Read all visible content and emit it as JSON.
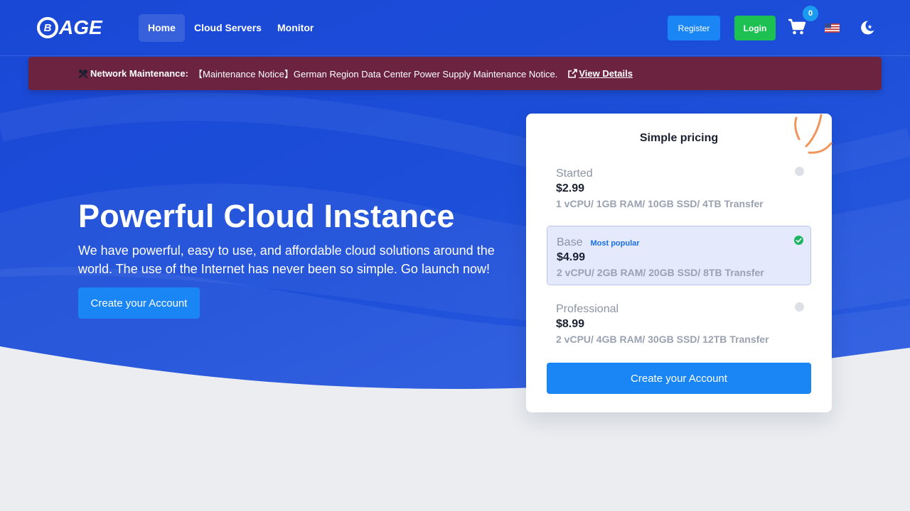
{
  "brand": {
    "logo_text": "AGE",
    "logo_mark": "B"
  },
  "nav": {
    "items": [
      {
        "label": "Home",
        "active": true
      },
      {
        "label": "Cloud Servers",
        "active": false
      },
      {
        "label": "Monitor",
        "active": false
      }
    ],
    "register_label": "Register",
    "login_label": "Login",
    "cart_count": "0",
    "icons": {
      "cart": "cart-icon",
      "language": "us-flag-icon",
      "theme": "moon-star-icon"
    }
  },
  "notice": {
    "label": "Network Maintenance:",
    "text": "【Maintenance Notice】German Region Data Center Power Supply Maintenance Notice.",
    "link_label": "View Details",
    "icons": {
      "label": "tools-icon",
      "link": "external-link-icon"
    }
  },
  "hero": {
    "title": "Powerful Cloud Instance",
    "description": "We have powerful, easy to use, and affordable cloud solutions around the world. The use of the Internet has never been so simple. Go launch now!",
    "cta_label": "Create your Account"
  },
  "pricing": {
    "title": "Simple pricing",
    "plans": [
      {
        "name": "Started",
        "badge": "",
        "price": "$2.99",
        "specs": "1 vCPU/ 1GB RAM/ 10GB SSD/ 4TB Transfer",
        "selected": false
      },
      {
        "name": "Base",
        "badge": "Most popular",
        "price": "$4.99",
        "specs": "2 vCPU/ 2GB RAM/ 20GB SSD/ 8TB Transfer",
        "selected": true
      },
      {
        "name": "Professional",
        "badge": "",
        "price": "$8.99",
        "specs": "2 vCPU/ 4GB RAM/ 30GB SSD/ 12TB Transfer",
        "selected": false
      }
    ],
    "cta_label": "Create your Account"
  },
  "colors": {
    "hero_blue": "#1d4fd8",
    "primary_button": "#1a86f5",
    "login_green": "#1cc152",
    "notice_bg": "#6c2340",
    "page_bg": "#ebedf0",
    "selected_plan_bg": "#e4eafc",
    "check_green": "#1cb562"
  }
}
